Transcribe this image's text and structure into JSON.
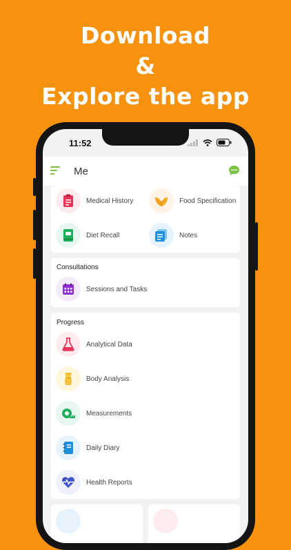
{
  "promo": {
    "line1": "Download",
    "line2": "&",
    "line3": "Explore the app"
  },
  "colors": {
    "background": "#F7920F",
    "accent_green": "#7BC142"
  },
  "status": {
    "time": "11:52"
  },
  "appbar": {
    "title": "Me",
    "menu_icon": "menu-lines-icon",
    "chat_icon": "chat-bubble-icon"
  },
  "top_section": {
    "items": [
      {
        "label": "Medical History",
        "icon": "clipboard-icon"
      },
      {
        "label": "Food Specification",
        "icon": "leaf-icon"
      },
      {
        "label": "Diet Recall",
        "icon": "notebook-icon"
      },
      {
        "label": "Notes",
        "icon": "notes-icon"
      }
    ]
  },
  "consultations": {
    "title": "Consultations",
    "items": [
      {
        "label": "Sessions and Tasks",
        "icon": "calendar-icon"
      }
    ]
  },
  "progress": {
    "title": "Progress",
    "items": [
      {
        "label": "Analytical Data",
        "icon": "flask-icon"
      },
      {
        "label": "Body Analysis",
        "icon": "body-icon"
      },
      {
        "label": "Measurements",
        "icon": "tape-measure-icon"
      },
      {
        "label": "Daily Diary",
        "icon": "diary-icon"
      },
      {
        "label": "Health Reports",
        "icon": "heartbeat-icon"
      }
    ]
  }
}
